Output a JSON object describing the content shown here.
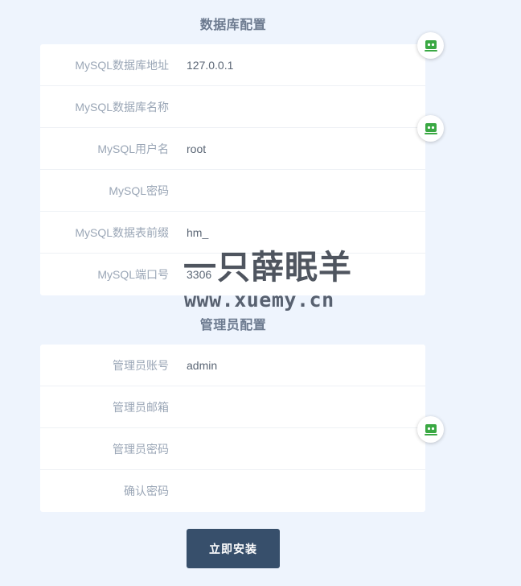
{
  "db_section": {
    "title": "数据库配置",
    "fields": [
      {
        "label": "MySQL数据库地址",
        "value": "127.0.0.1"
      },
      {
        "label": "MySQL数据库名称",
        "value": ""
      },
      {
        "label": "MySQL用户名",
        "value": "root"
      },
      {
        "label": "MySQL密码",
        "value": ""
      },
      {
        "label": "MySQL数据表前缀",
        "value": "hm_"
      },
      {
        "label": "MySQL端口号",
        "value": "3306"
      }
    ]
  },
  "admin_section": {
    "title": "管理员配置",
    "fields": [
      {
        "label": "管理员账号",
        "value": "admin"
      },
      {
        "label": "管理员邮箱",
        "value": ""
      },
      {
        "label": "管理员密码",
        "value": ""
      },
      {
        "label": "确认密码",
        "value": ""
      }
    ]
  },
  "install_button": {
    "label": "立即安装"
  },
  "watermark": {
    "text": "一只薛眠羊",
    "url": "www.xuemy.cn"
  },
  "floating_icon": {
    "icon": "password-manager-icon",
    "color": "#3aa843"
  },
  "colors": {
    "background": "#eef4fd",
    "card": "#ffffff",
    "label": "#9aa6b6",
    "value": "#5b6675",
    "title": "#6c7a8f",
    "button": "#374f6b"
  }
}
